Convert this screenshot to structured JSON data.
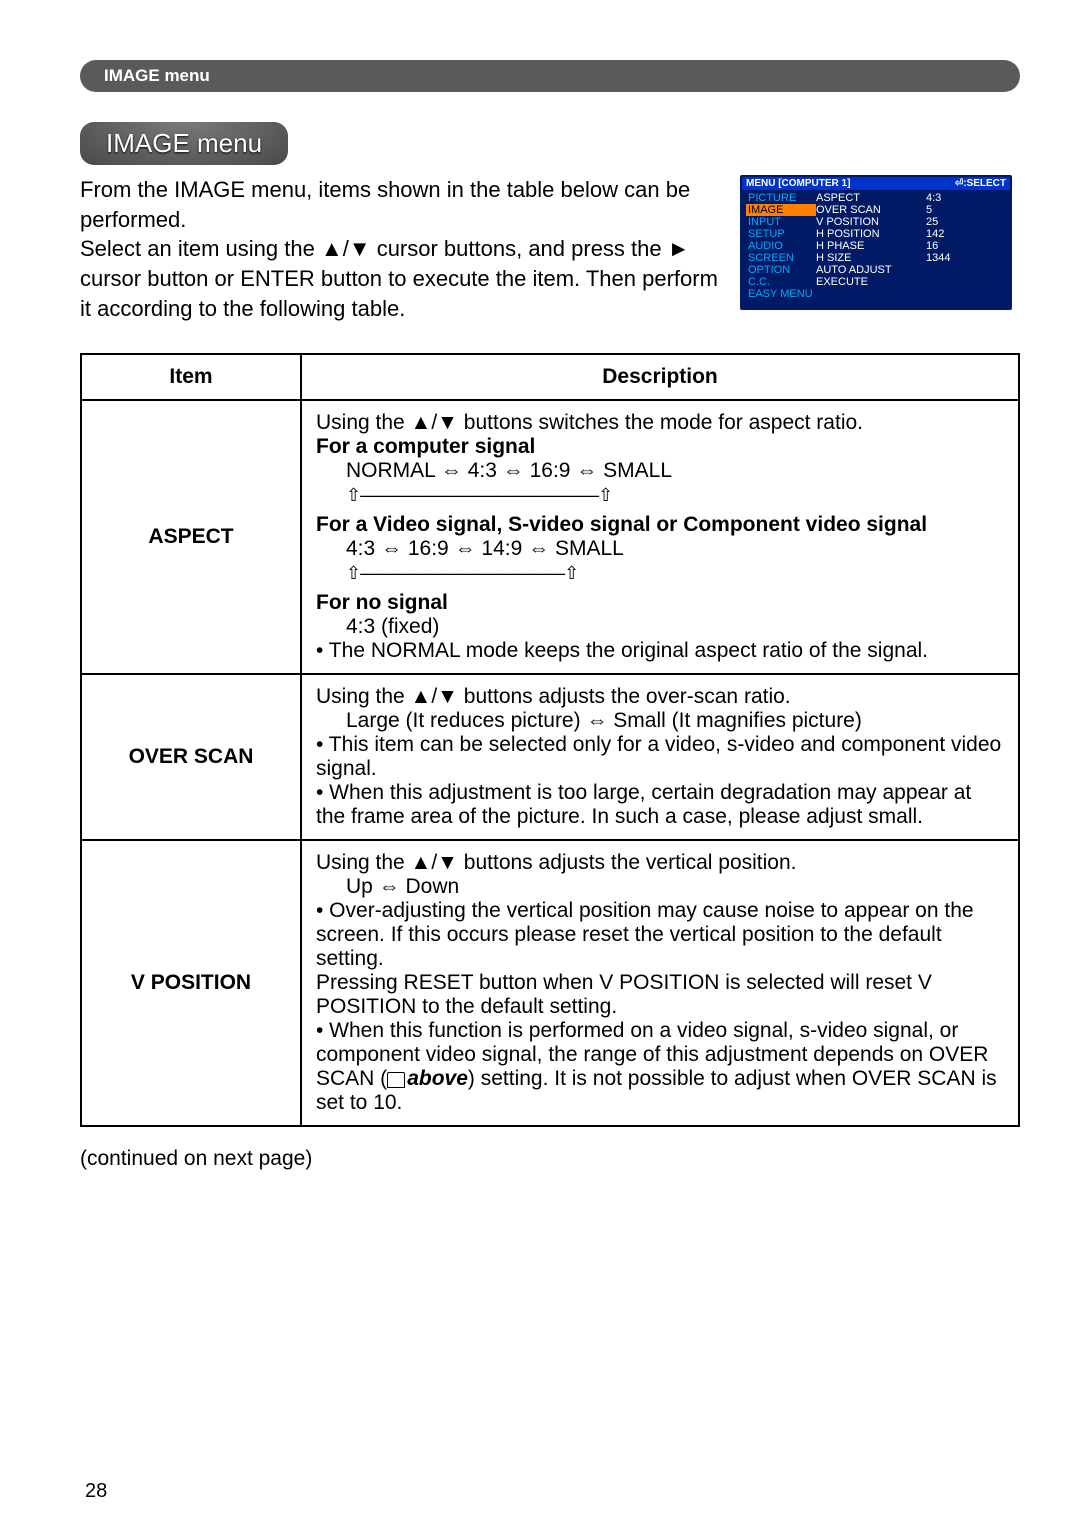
{
  "topBanner": "IMAGE menu",
  "sectionTitle": "IMAGE menu",
  "intro": "From the IMAGE menu, items shown in the table below can be performed.\nSelect an item using the ▲/▼ cursor buttons, and press the ► cursor button or ENTER button to execute the item. Then perform it according to the following table.",
  "osd": {
    "headerLeft": "MENU [COMPUTER 1]",
    "headerRight": "⏎:SELECT",
    "leftItems": [
      "PICTURE",
      "IMAGE",
      "INPUT",
      "SETUP",
      "AUDIO",
      "SCREEN",
      "OPTION",
      "C.C.",
      "EASY MENU"
    ],
    "highlightIndex": 1,
    "midItems": [
      "ASPECT",
      "OVER SCAN",
      "V POSITION",
      "H POSITION",
      "H PHASE",
      "H SIZE",
      "AUTO ADJUST EXECUTE"
    ],
    "rightItems": [
      "4:3",
      "5",
      "25",
      "142",
      "16",
      "1344",
      ""
    ]
  },
  "table": {
    "headers": {
      "item": "Item",
      "description": "Description"
    },
    "rows": [
      {
        "item": "ASPECT",
        "intro": "Using the ▲/▼ buttons switches the mode for aspect ratio.",
        "sub1Title": "For a computer signal",
        "sub1Body": "NORMAL ⇔ 4:3 ⇔ 16:9 ⇔ SMALL",
        "sub2Title": "For a Video signal, S-video signal or Component video signal",
        "sub2Body": "4:3 ⇔ 16:9 ⇔ 14:9 ⇔ SMALL",
        "sub3Title": "For no signal",
        "sub3Body": "4:3 (fixed)",
        "note": "• The NORMAL mode keeps the original aspect ratio of the signal."
      },
      {
        "item": "OVER SCAN",
        "intro": "Using the ▲/▼ buttons adjusts the over-scan ratio.",
        "range": "Large (It reduces picture) ⇔ Small (It magnifies picture)",
        "notes": [
          "• This item can be selected only for a video, s-video and component video signal.",
          "• When this adjustment is too large, certain degradation may appear at the frame area of the picture. In such a case, please adjust small."
        ]
      },
      {
        "item": "V POSITION",
        "intro": "Using the ▲/▼ buttons adjusts the vertical position.",
        "range": "Up ⇔ Down",
        "note1": "• Over-adjusting the vertical position may cause noise to appear on the screen. If this occurs please reset the vertical position to the default setting.",
        "note2": "Pressing RESET button when V POSITION is selected will reset V POSITION to the default setting.",
        "note3a": "• When this function is performed on a video signal, s-video signal, or component video signal, the range of this adjustment depends on OVER SCAN (",
        "note3ref": "above",
        "note3b": ") setting. It is not possible to adjust when OVER SCAN is set to 10."
      }
    ]
  },
  "continued": "(continued on next page)",
  "pageNumber": "28"
}
